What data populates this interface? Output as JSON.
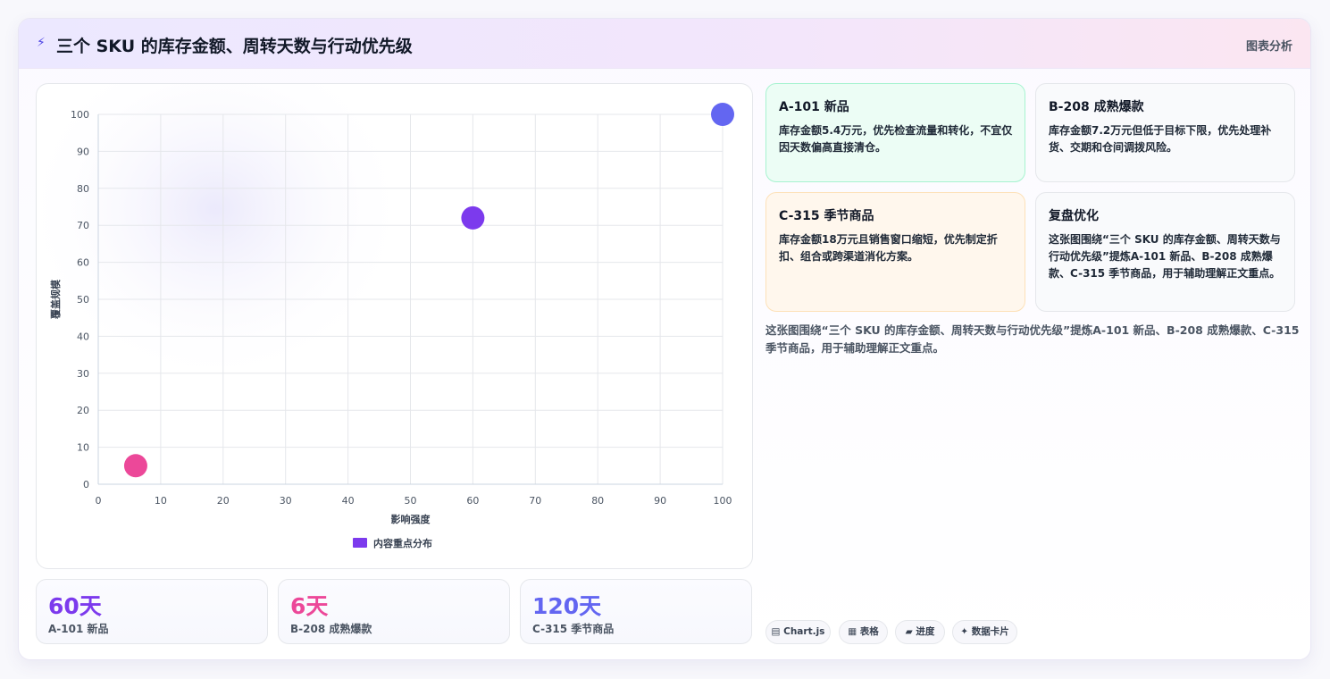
{
  "header": {
    "title": "三个 SKU 的库存金额、周转天数与行动优先级",
    "tag": "图表分析"
  },
  "chart_data": {
    "type": "scatter",
    "xlabel": "影响强度",
    "ylabel": "覆盖规模",
    "xlim": [
      0,
      100
    ],
    "ylim": [
      0,
      100
    ],
    "x_ticks": [
      0,
      10,
      20,
      30,
      40,
      50,
      60,
      70,
      80,
      90,
      100
    ],
    "y_ticks": [
      0,
      10,
      20,
      30,
      40,
      50,
      60,
      70,
      80,
      90,
      100
    ],
    "grid": true,
    "legend": {
      "position": "bottom",
      "label": "内容重点分布",
      "color": "#7c3aed"
    },
    "points": [
      {
        "x": 6,
        "y": 5,
        "color": "#ec4899"
      },
      {
        "x": 60,
        "y": 72,
        "color": "#7c3aed"
      },
      {
        "x": 100,
        "y": 100,
        "color": "#6366f1"
      }
    ]
  },
  "stats": [
    {
      "value": "60天",
      "label": "A-101 新品",
      "color": "#7c3aed"
    },
    {
      "value": "6天",
      "label": "B-208 成熟爆款",
      "color": "#ec4899"
    },
    {
      "value": "120天",
      "label": "C-315 季节商品",
      "color": "#6366f1"
    }
  ],
  "cards": [
    {
      "title": "A-101 新品",
      "body": "库存金额5.4万元，优先检查流量和转化，不宜仅因天数偏高直接清仓。",
      "bg": "#ecfdf5",
      "border": "#a7f3d0"
    },
    {
      "title": "B-208 成熟爆款",
      "body": "库存金额7.2万元但低于目标下限，优先处理补货、交期和仓间调拨风险。",
      "bg": "#f9fafc",
      "border": "#e5e7eb"
    },
    {
      "title": "C-315 季节商品",
      "body": "库存金额18万元且销售窗口缩短，优先制定折扣、组合或跨渠道消化方案。",
      "bg": "#fff7ed",
      "border": "#fde1b8"
    },
    {
      "title": "复盘优化",
      "body": "这张图围绕“三个 SKU 的库存金额、周转天数与行动优先级”提炼A-101 新品、B-208 成熟爆款、C-315 季节商品，用于辅助理解正文重点。",
      "bg": "#f9fafc",
      "border": "#e5e7eb"
    }
  ],
  "summary": "这张图围绕“三个 SKU 的库存金额、周转天数与行动优先级”提炼A-101 新品、B-208 成熟爆款、C-315 季节商品，用于辅助理解正文重点。",
  "chips": [
    {
      "icon": "▤",
      "label": "Chart.js"
    },
    {
      "icon": "▦",
      "label": "表格"
    },
    {
      "icon": "▰",
      "label": "进度"
    },
    {
      "icon": "✦",
      "label": "数据卡片"
    }
  ]
}
